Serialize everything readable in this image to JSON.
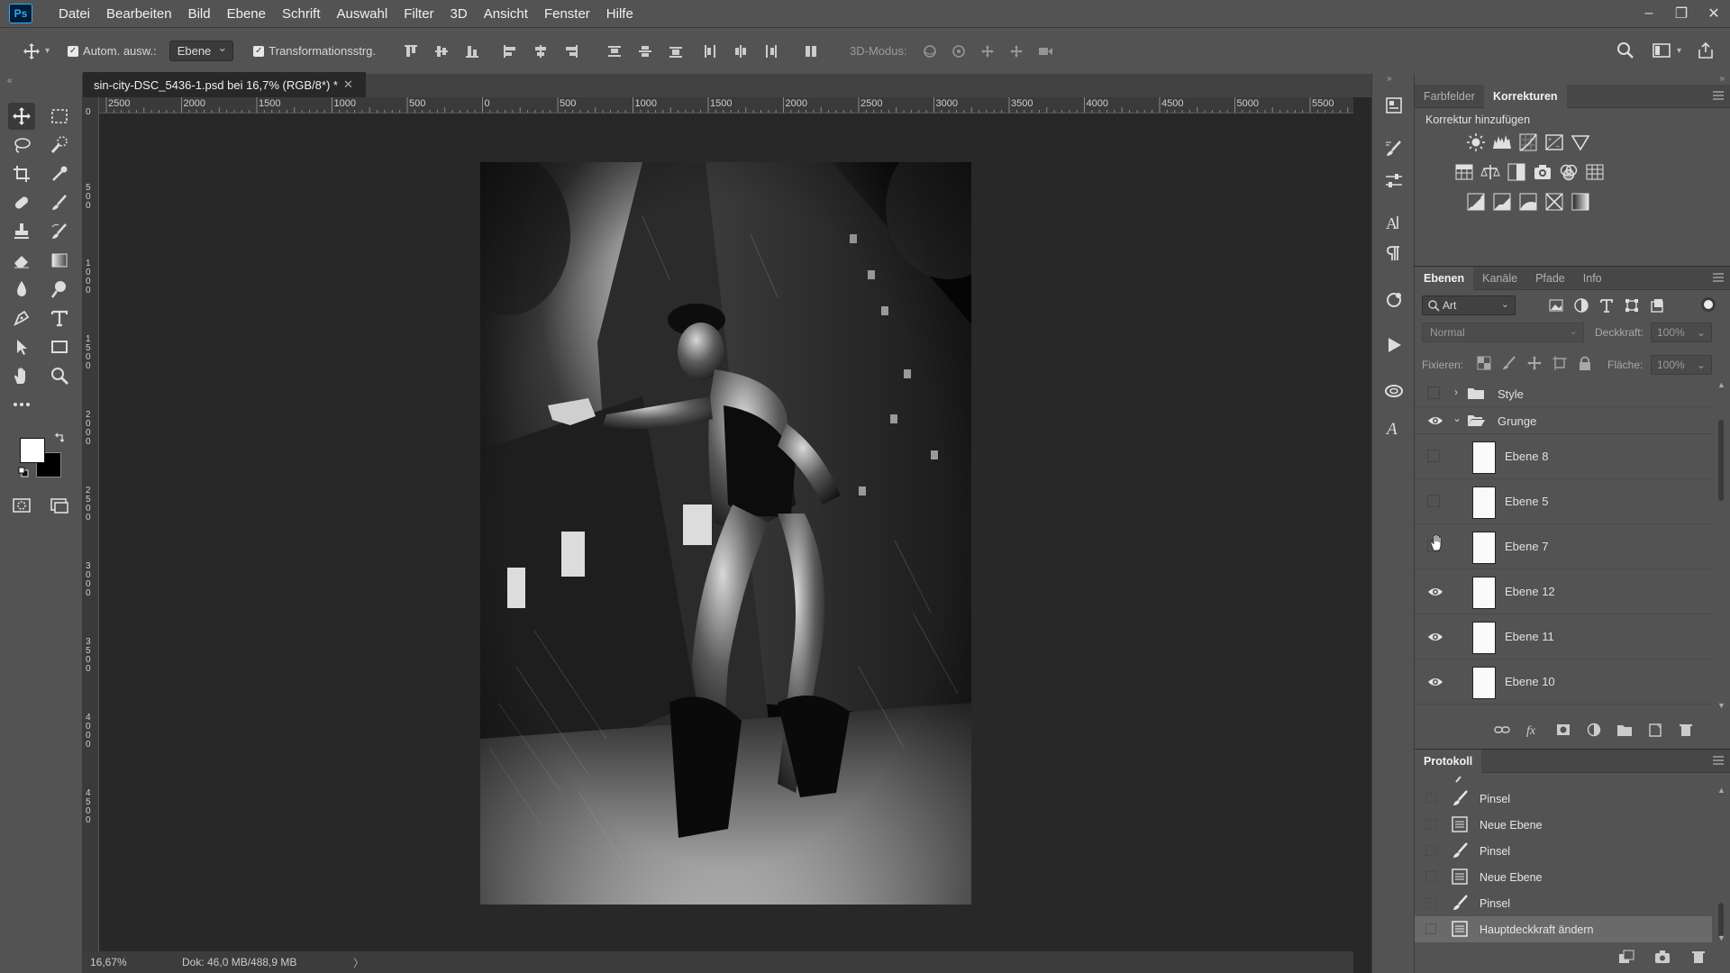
{
  "app": {
    "logo": "Ps"
  },
  "menu": [
    "Datei",
    "Bearbeiten",
    "Bild",
    "Ebene",
    "Schrift",
    "Auswahl",
    "Filter",
    "3D",
    "Ansicht",
    "Fenster",
    "Hilfe"
  ],
  "window_controls": {
    "minimize": "–",
    "restore": "❐",
    "close": "✕"
  },
  "options": {
    "auto_select_label": "Autom. ausw.:",
    "auto_select_target": "Ebene",
    "transform_label": "Transformationsstrg.",
    "mode_3d_label": "3D-Modus:"
  },
  "document": {
    "tab_title": "sin-city-DSC_5436-1.psd bei 16,7% (RGB/8*) *",
    "ruler_h": [
      "2500",
      "2000",
      "1500",
      "1000",
      "500",
      "0",
      "500",
      "1000",
      "1500",
      "2000",
      "2500",
      "3000",
      "3500",
      "4000",
      "4500",
      "5000",
      "5500"
    ],
    "ruler_v": [
      "0",
      "5\n0\n0",
      "1\n0\n0\n0",
      "1\n5\n0\n0",
      "2\n0\n0\n0",
      "2\n5\n0\n0",
      "3\n0\n0\n0",
      "3\n5\n0\n0",
      "4\n0\n0\n0",
      "4\n5\n0\n0"
    ],
    "zoom": "16,67%",
    "doc_info": "Dok: 46,0 MB/488,9 MB"
  },
  "colors": {
    "foreground": "#ffffff",
    "background": "#000000",
    "accent": "#31a8ff"
  },
  "corrections_panel": {
    "tabs": [
      "Farbfelder",
      "Korrekturen"
    ],
    "active_tab": "Korrekturen",
    "title": "Korrektur hinzufügen"
  },
  "layers_panel": {
    "tabs": [
      "Ebenen",
      "Kanäle",
      "Pfade",
      "Info"
    ],
    "active_tab": "Ebenen",
    "filter_kind": "Art",
    "blend_mode": "Normal",
    "opacity_label": "Deckkraft:",
    "opacity_value": "100%",
    "lock_label": "Fixieren:",
    "fill_label": "Fläche:",
    "fill_value": "100%",
    "groups": [
      {
        "name": "Style",
        "expanded": false,
        "visible": false
      },
      {
        "name": "Grunge",
        "expanded": true,
        "visible": true
      }
    ],
    "layers": [
      {
        "name": "Ebene 8",
        "visible": false
      },
      {
        "name": "Ebene 5",
        "visible": false
      },
      {
        "name": "Ebene 7",
        "visible": false
      },
      {
        "name": "Ebene 12",
        "visible": true
      },
      {
        "name": "Ebene 11",
        "visible": true
      },
      {
        "name": "Ebene 10",
        "visible": true
      }
    ]
  },
  "history_panel": {
    "title": "Protokoll",
    "items": [
      {
        "label": "Pinsel",
        "icon": "brush-icon"
      },
      {
        "label": "Neue Ebene",
        "icon": "document-icon"
      },
      {
        "label": "Pinsel",
        "icon": "brush-icon"
      },
      {
        "label": "Neue Ebene",
        "icon": "document-icon"
      },
      {
        "label": "Pinsel",
        "icon": "brush-icon"
      },
      {
        "label": "Hauptdeckkraft ändern",
        "icon": "document-icon",
        "selected": true
      }
    ]
  }
}
